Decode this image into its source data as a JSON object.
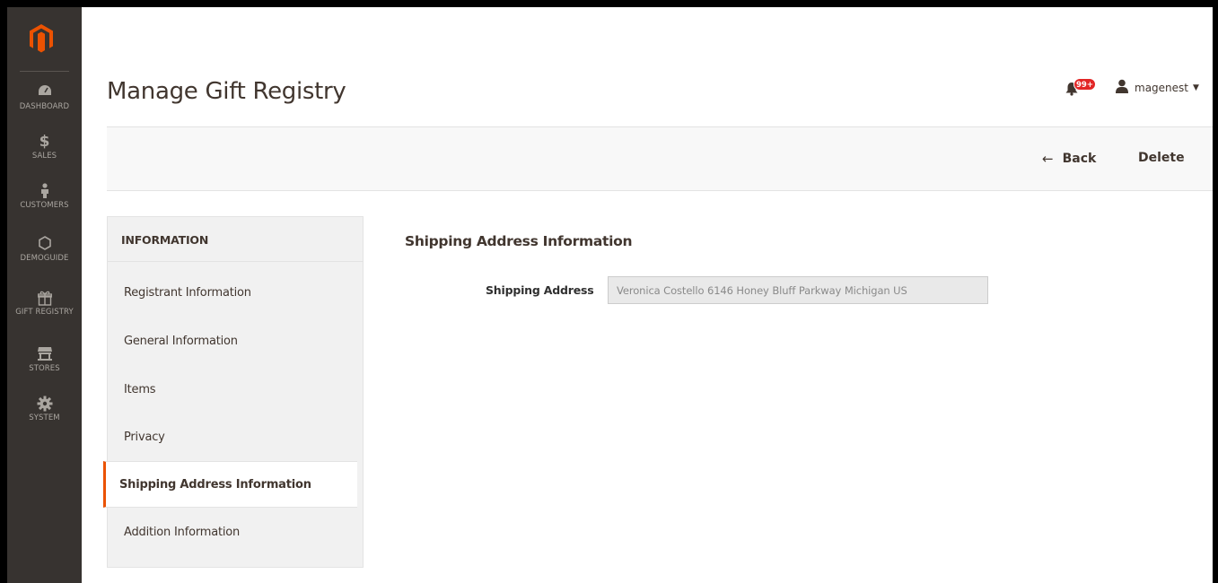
{
  "menu": {
    "items": [
      {
        "label": "DASHBOARD",
        "icon": "dashboard-icon"
      },
      {
        "label": "SALES",
        "icon": "dollar-icon"
      },
      {
        "label": "CUSTOMERS",
        "icon": "customer-icon"
      },
      {
        "label": "DEMOGUIDE",
        "icon": "hexagon-icon"
      },
      {
        "label": "GIFT REGISTRY",
        "icon": "gift-icon"
      },
      {
        "label": "STORES",
        "icon": "store-icon"
      },
      {
        "label": "SYSTEM",
        "icon": "gear-icon"
      }
    ]
  },
  "header": {
    "title": "Manage Gift Registry",
    "notifications_count": "99+",
    "username": "magenest"
  },
  "actions": {
    "back_label": "Back",
    "delete_label": "Delete"
  },
  "tabs": {
    "title": "INFORMATION",
    "items": [
      {
        "label": "Registrant Information"
      },
      {
        "label": "General Information"
      },
      {
        "label": "Items"
      },
      {
        "label": "Privacy"
      },
      {
        "label": "Shipping Address Information",
        "active": true
      },
      {
        "label": "Addition Information"
      }
    ]
  },
  "content": {
    "section_title": "Shipping Address Information",
    "field_label": "Shipping Address",
    "field_value": "Veronica Costello 6146 Honey Bluff Parkway Michigan US"
  },
  "colors": {
    "menu_bg": "#373330",
    "accent": "#eb5202",
    "logo": "#eb5202",
    "badge": "#e22626"
  }
}
